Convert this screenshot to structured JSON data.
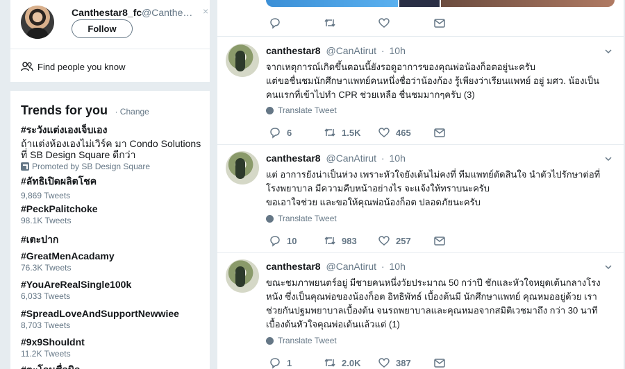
{
  "who_to_follow": {
    "name": "Canthestar8_fc",
    "handle": "@Canthest...",
    "close_glyph": "×",
    "follow_label": "Follow",
    "find_people": "Find people you know"
  },
  "trends": {
    "title": "Trends for you",
    "change": "· Change",
    "items": [
      {
        "name": "#ระวังแต่งเองเจ็บเอง",
        "desc_line1": "ถ้าแต่งห้องเองไม่เวิร์ค มา Condo Solutions",
        "desc_line2": "ที่ SB Design Square ดีกว่า",
        "promoted": "Promoted by SB Design Square"
      },
      {
        "name": "#ลัทธิเปิดผลิตโชค",
        "count": "9,869 Tweets"
      },
      {
        "name": "#PeckPalitchoke",
        "count": "98.1K Tweets"
      },
      {
        "name": "#เตะปาก"
      },
      {
        "name": "#GreatMenAcadamy",
        "count": "76.3K Tweets"
      },
      {
        "name": "#YouAreRealSingle100k",
        "count": "6,033 Tweets"
      },
      {
        "name": "#SpreadLoveAndSupportNewwiee",
        "count": "8,703 Tweets"
      },
      {
        "name": "#9x9Shouldnt",
        "count": "11.2K Tweets"
      },
      {
        "name": "#ตะโกนชื่อนิว"
      }
    ]
  },
  "tweets": [
    {
      "name": "canthestar8",
      "handle": "@CanAtirut",
      "dot": "·",
      "time": "10h",
      "lines": [
        "จากเหตุการณ์เกิดขึ้นตอนนี้ยังรอดูอาการของคุณพ่อน้องก็อตอยู่นะครับ",
        "แต่ขอชื่นชมนักศึกษาแพทย์คนหนึ่งชื่อว่าน้องก้อง รู้เพียงว่าเรียนแพทย์ อยู่ มศว. น้องเป็น",
        "คนแรกที่เข้าไปทำ CPR ช่วยเหลือ ชื่นชมมากๆครับ (3)"
      ],
      "translate": "Translate Tweet",
      "replies": "6",
      "retweets": "1.5K",
      "likes": "465"
    },
    {
      "name": "canthestar8",
      "handle": "@CanAtirut",
      "dot": "·",
      "time": "10h",
      "lines": [
        "แต่ อาการยังน่าเป็นห่วง เพราะหัวใจยังเต้นไม่คงที่ ทีมแพทย์ตัดสินใจ นำตัวไปรักษาต่อที่",
        "โรงพยาบาล มีความคืบหน้าอย่างไร จะแจ้งให้ทราบนะครับ",
        "ขอเอาใจช่วย และขอให้คุณพ่อน้องก็อต ปลอดภัยนะครับ"
      ],
      "translate": "Translate Tweet",
      "replies": "10",
      "retweets": "983",
      "likes": "257"
    },
    {
      "name": "canthestar8",
      "handle": "@CanAtirut",
      "dot": "·",
      "time": "10h",
      "lines": [
        "ขณะชมภาพยนตร์อยู่ มีชายคนหนึ่งวัยประมาณ 50 กว่าปี ชักและหัวใจหยุดเต้นกลางโรง",
        "หนัง ซึ่งเป็นคุณพ่อของน้องก็อต อิทธิพัทธ์ เบื้องต้นมี นักศึกษาแพทย์ คุณหมออยู่ด้วย เรา",
        "ช่วยกันปฐมพยาบาลเบื้องต้น จนรถพยาบาลและคุณหมอจากสมิติเวชมาถึง กว่า 30 นาที",
        "เบื้องต้นหัวใจคุณพ่อเต้นแล้วแต่ (1)"
      ],
      "translate": "Translate Tweet",
      "replies": "1",
      "retweets": "2.0K",
      "likes": "387"
    }
  ],
  "colors": {
    "background": "#e6ecf0",
    "text": "#14171a",
    "muted": "#657786"
  }
}
